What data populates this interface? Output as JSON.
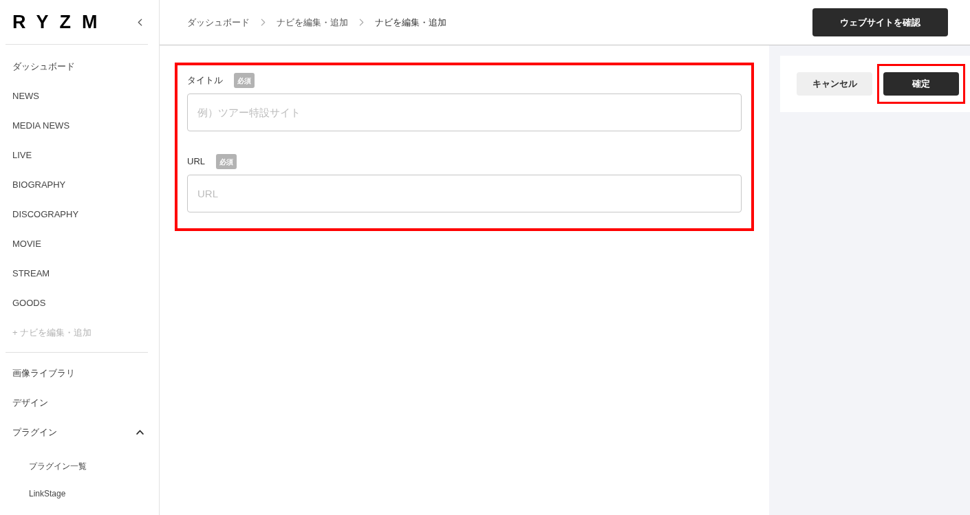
{
  "sidebar": {
    "logo": "RYZM",
    "nav_items": [
      {
        "label": "ダッシュボード"
      },
      {
        "label": "NEWS"
      },
      {
        "label": "MEDIA NEWS"
      },
      {
        "label": "LIVE"
      },
      {
        "label": "BIOGRAPHY"
      },
      {
        "label": "DISCOGRAPHY"
      },
      {
        "label": "MOVIE"
      },
      {
        "label": "STREAM"
      },
      {
        "label": "GOODS"
      }
    ],
    "add_nav": "+ ナビを編集・追加",
    "tools": [
      {
        "label": "画像ライブラリ"
      },
      {
        "label": "デザイン"
      },
      {
        "label": "プラグイン",
        "expanded": true,
        "children": [
          {
            "label": "プラグイン一覧"
          },
          {
            "label": "LinkStage"
          }
        ]
      }
    ]
  },
  "header": {
    "breadcrumbs": [
      "ダッシュボード",
      "ナビを編集・追加",
      "ナビを編集・追加"
    ],
    "view_site_button": "ウェブサイトを確認"
  },
  "form": {
    "highlighted": true,
    "fields": [
      {
        "label": "タイトル",
        "required_badge": "必須",
        "placeholder": "例）ツアー特設サイト"
      },
      {
        "label": "URL",
        "required_badge": "必須",
        "placeholder": "URL"
      }
    ]
  },
  "actions": {
    "cancel_button": {
      "label": "キャンセル"
    },
    "confirm_button": {
      "label": "確定",
      "highlighted": true
    }
  }
}
